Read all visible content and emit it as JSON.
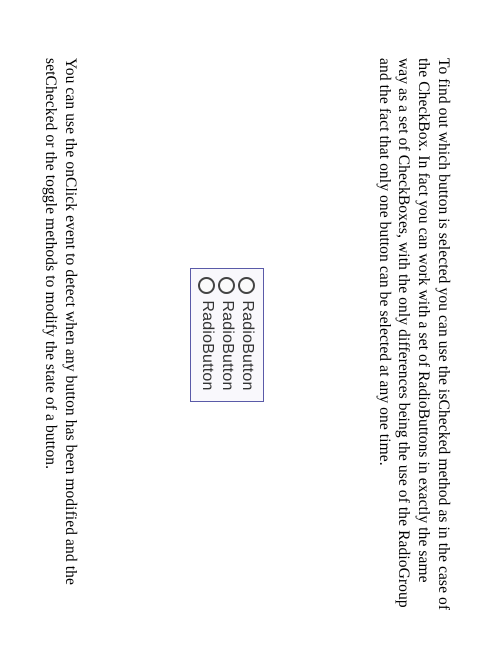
{
  "paragraphs": {
    "top": "To find out which button is selected you can use the isChecked method as in the case of the CheckBox. In fact you can work with a set of RadioButtons in exactly the same way as a set of CheckBoxes, with the only differences being the use of the RadioGroup and the fact that only one button can be selected at any one time.",
    "bottom": "You can use the onClick event to detect when any button has been modified and the setChecked or the toggle methods to modify the state of a button."
  },
  "radio_items": [
    {
      "label": "RadioButton"
    },
    {
      "label": "RadioButton"
    },
    {
      "label": "RadioButton"
    }
  ]
}
